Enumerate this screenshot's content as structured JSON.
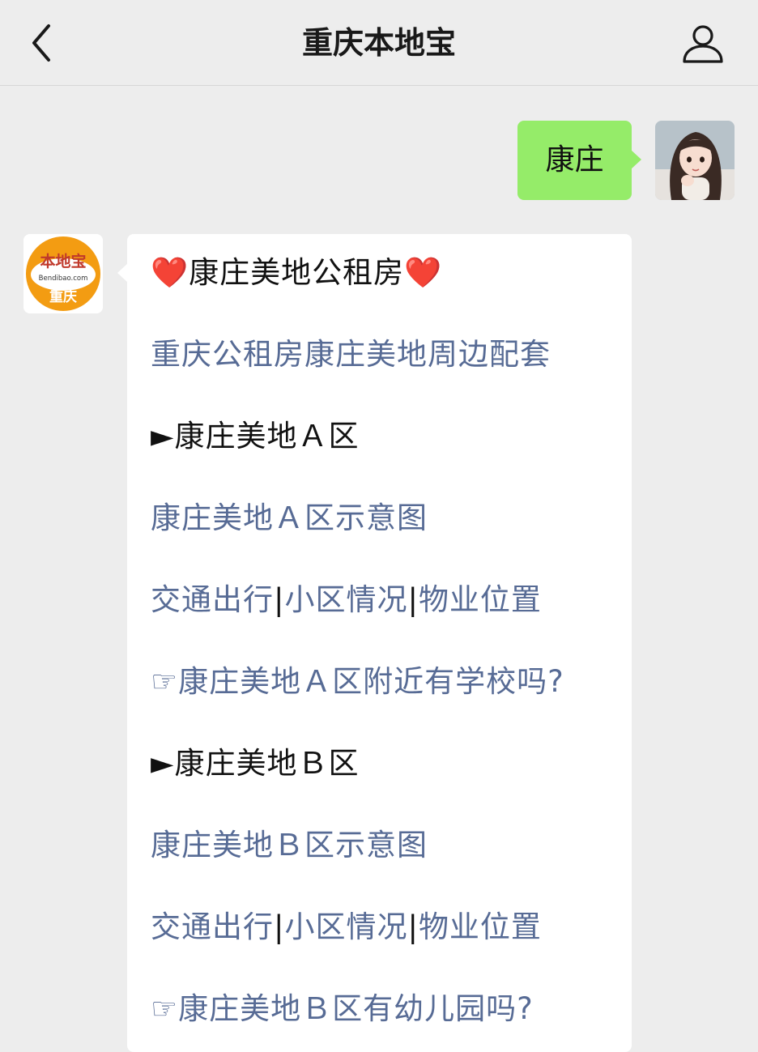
{
  "header": {
    "title": "重庆本地宝",
    "back_icon": "chevron-left-icon",
    "profile_icon": "user-icon"
  },
  "outgoing": {
    "text": "康庄"
  },
  "bot": {
    "logo_text": "本地宝",
    "logo_domain": "Bendibao.com",
    "logo_city": "重庆"
  },
  "reply": {
    "title": "❤️康庄美地公租房❤️",
    "intro_link": "重庆公租房康庄美地周边配套",
    "sections": [
      {
        "heading": "►康庄美地Ａ区",
        "map_link": "康庄美地Ａ区示意图",
        "nav_links": [
          "交通出行",
          "小区情况",
          "物业位置"
        ],
        "separator": "|",
        "question": "☞康庄美地Ａ区附近有学校吗?"
      },
      {
        "heading": "►康庄美地Ｂ区",
        "map_link": "康庄美地Ｂ区示意图",
        "nav_links": [
          "交通出行",
          "小区情况",
          "物业位置"
        ],
        "separator": "|",
        "question": "☞康庄美地Ｂ区有幼儿园吗?"
      }
    ]
  },
  "colors": {
    "link": "#576b95",
    "bubble_out": "#95ec69",
    "bubble_in": "#ffffff",
    "background": "#ededed",
    "logo_orange": "#f39c12"
  }
}
